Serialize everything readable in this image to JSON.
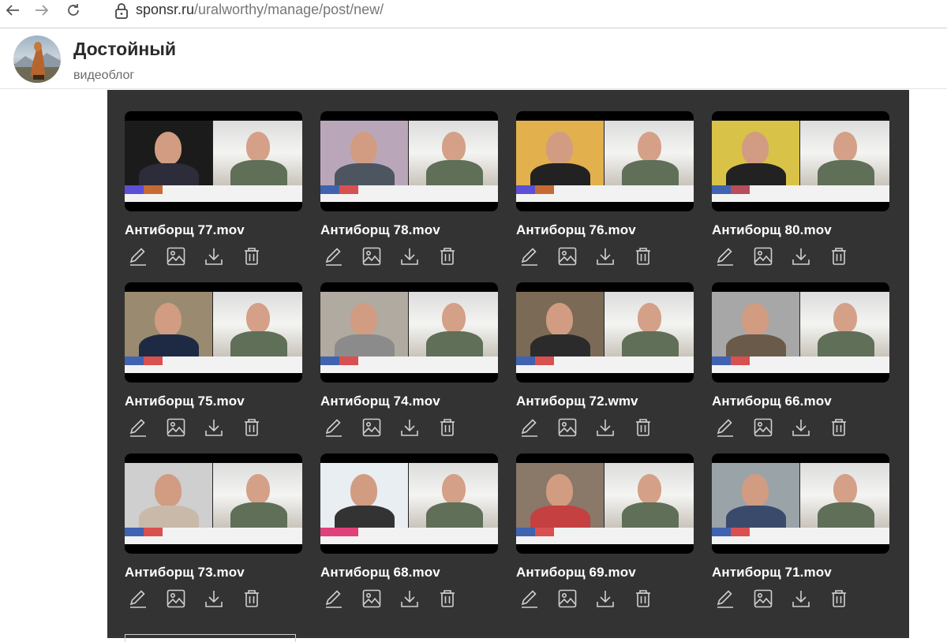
{
  "browser": {
    "url_domain": "sponsr.ru",
    "url_path": "/uralworthy/manage/post/new/"
  },
  "header": {
    "title": "Достойный",
    "subtitle": "видеоблог"
  },
  "videos": [
    {
      "title": "Антиборщ 77.mov"
    },
    {
      "title": "Антиборщ 78.mov"
    },
    {
      "title": "Антиборщ 76.mov"
    },
    {
      "title": "Антиборщ 80.mov"
    },
    {
      "title": "Антиборщ 75.mov"
    },
    {
      "title": "Антиборщ 74.mov"
    },
    {
      "title": "Антиборщ 72.wmv"
    },
    {
      "title": "Антиборщ 66.mov"
    },
    {
      "title": "Антиборщ 73.mov"
    },
    {
      "title": "Антиборщ 68.mov"
    },
    {
      "title": "Антиборщ 69.mov"
    },
    {
      "title": "Антиборщ 71.mov"
    }
  ],
  "icons": {
    "edit": "pencil-icon",
    "cover": "image-icon",
    "download": "download-icon",
    "delete": "trash-icon"
  }
}
